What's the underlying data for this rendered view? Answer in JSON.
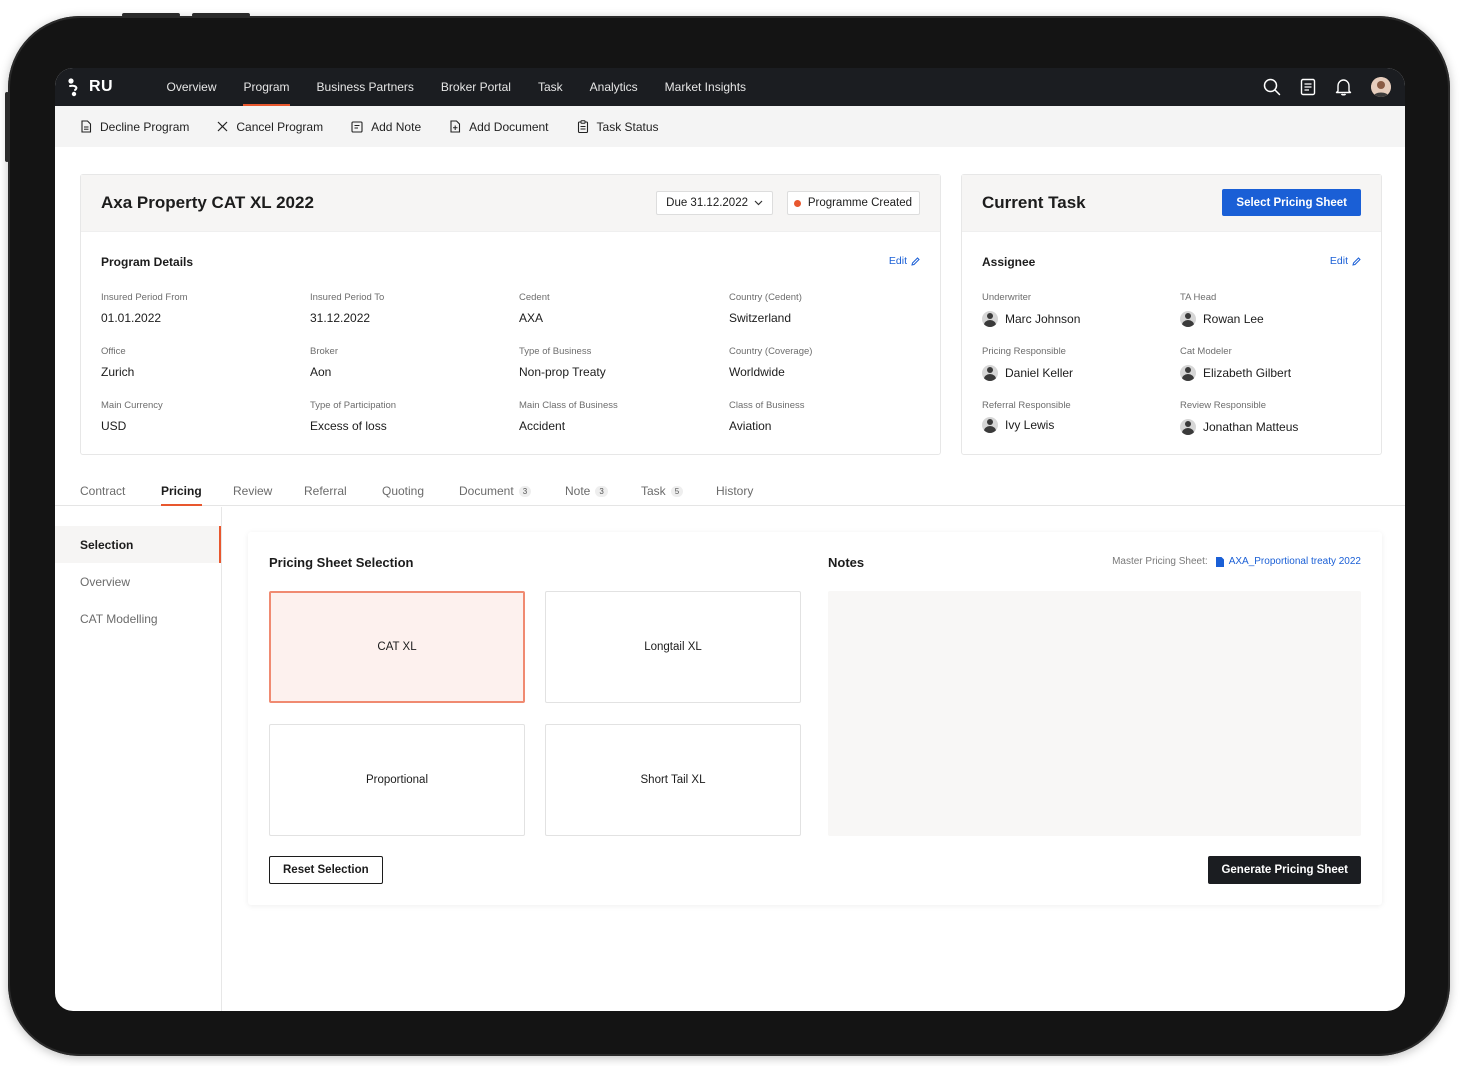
{
  "brand": {
    "name": "RU"
  },
  "nav": {
    "items": [
      {
        "label": "Overview"
      },
      {
        "label": "Program"
      },
      {
        "label": "Business Partners"
      },
      {
        "label": "Broker Portal"
      },
      {
        "label": "Task"
      },
      {
        "label": "Analytics"
      },
      {
        "label": "Market Insights"
      }
    ],
    "active": "Program",
    "icons": [
      "search-icon",
      "document-list-icon",
      "bell-icon",
      "user-avatar"
    ]
  },
  "actions": [
    {
      "label": "Decline Program",
      "icon": "document-icon"
    },
    {
      "label": "Cancel Program",
      "icon": "close-icon"
    },
    {
      "label": "Add Note",
      "icon": "note-icon"
    },
    {
      "label": "Add Document",
      "icon": "add-document-icon"
    },
    {
      "label": "Task Status",
      "icon": "clipboard-icon"
    }
  ],
  "program": {
    "title": "Axa Property CAT XL 2022",
    "due": "Due 31.12.2022",
    "status": "Programme Created",
    "details_title": "Program Details",
    "edit_label": "Edit",
    "fields": [
      {
        "label": "Insured Period From",
        "value": "01.01.2022"
      },
      {
        "label": "Insured Period To",
        "value": "31.12.2022"
      },
      {
        "label": "Cedent",
        "value": "AXA"
      },
      {
        "label": "Country (Cedent)",
        "value": "Switzerland"
      },
      {
        "label": "Office",
        "value": "Zurich"
      },
      {
        "label": "Broker",
        "value": "Aon"
      },
      {
        "label": "Type of Business",
        "value": "Non-prop Treaty"
      },
      {
        "label": "Country (Coverage)",
        "value": "Worldwide"
      },
      {
        "label": "Main Currency",
        "value": "USD"
      },
      {
        "label": "Type of Participation",
        "value": "Excess of loss"
      },
      {
        "label": "Main Class of Business",
        "value": "Accident"
      },
      {
        "label": "Class of Business",
        "value": "Aviation"
      }
    ]
  },
  "current_task": {
    "title": "Current Task",
    "action_label": "Select Pricing Sheet",
    "assignee_title": "Assignee",
    "edit_label": "Edit",
    "assignees": [
      {
        "role": "Underwriter",
        "name": "Marc Johnson"
      },
      {
        "role": "TA Head",
        "name": "Rowan Lee"
      },
      {
        "role": "Pricing Responsible",
        "name": "Daniel Keller"
      },
      {
        "role": "Cat Modeler",
        "name": "Elizabeth Gilbert"
      },
      {
        "role": "Referral Responsible",
        "name": "Ivy Lewis"
      },
      {
        "role": "Review Responsible",
        "name": "Jonathan Matteus"
      }
    ]
  },
  "tabs": [
    {
      "label": "Contract"
    },
    {
      "label": "Pricing"
    },
    {
      "label": "Review"
    },
    {
      "label": "Referral"
    },
    {
      "label": "Quoting"
    },
    {
      "label": "Document",
      "count": "3"
    },
    {
      "label": "Note",
      "count": "3"
    },
    {
      "label": "Task",
      "count": "5"
    },
    {
      "label": "History"
    }
  ],
  "active_tab": "Pricing",
  "sidebar": {
    "items": [
      {
        "label": "Selection"
      },
      {
        "label": "Overview"
      },
      {
        "label": "CAT Modelling"
      }
    ],
    "active": "Selection"
  },
  "pricing": {
    "title": "Pricing Sheet Selection",
    "options": [
      {
        "label": "CAT XL",
        "selected": true
      },
      {
        "label": "Longtail XL",
        "selected": false
      },
      {
        "label": "Proportional",
        "selected": false
      },
      {
        "label": "Short Tail XL",
        "selected": false
      }
    ],
    "notes_title": "Notes",
    "master_label": "Master Pricing Sheet:",
    "master_link": "AXA_Proportional treaty 2022",
    "reset_label": "Reset Selection",
    "generate_label": "Generate Pricing Sheet"
  },
  "colors": {
    "accent": "#e8572e",
    "primary_blue": "#1a5fd6",
    "nav_bg": "#1b1d21",
    "selected_tile_bg": "#fdf1ee"
  }
}
